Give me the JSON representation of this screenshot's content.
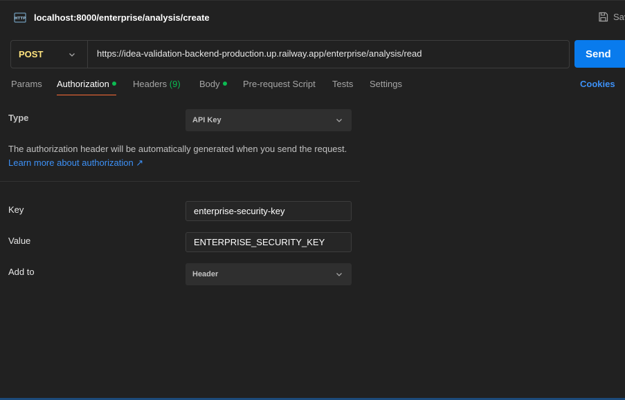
{
  "request": {
    "title": "localhost:8000/enterprise/analysis/create",
    "save_label": "Save",
    "method": "POST",
    "url": "https://idea-validation-backend-production.up.railway.app/enterprise/analysis/read",
    "send_label": "Send"
  },
  "tabs": {
    "params": "Params",
    "authorization": "Authorization",
    "headers": "Headers",
    "headers_count": "(9)",
    "body": "Body",
    "prerequest": "Pre-request Script",
    "tests": "Tests",
    "settings": "Settings",
    "cookies": "Cookies"
  },
  "auth": {
    "type_label": "Type",
    "type_value": "API Key",
    "description": "The authorization header will be automatically generated when you send the request.",
    "learn_more": "Learn more about authorization ↗",
    "key_label": "Key",
    "key_value": "enterprise-security-key",
    "value_label": "Value",
    "value_value": "ENTERPRISE_SECURITY_KEY",
    "addto_label": "Add to",
    "addto_value": "Header"
  },
  "colors": {
    "background": "#212121",
    "method_post": "#ffe47e",
    "send_button": "#097bed",
    "active_tab_underline": "#ff6c37",
    "status_dot": "#0cbb52",
    "link": "#3d91f7"
  },
  "icons": {
    "request_type": "http-icon",
    "save": "save-icon",
    "dropdown": "chevron-down-icon"
  }
}
